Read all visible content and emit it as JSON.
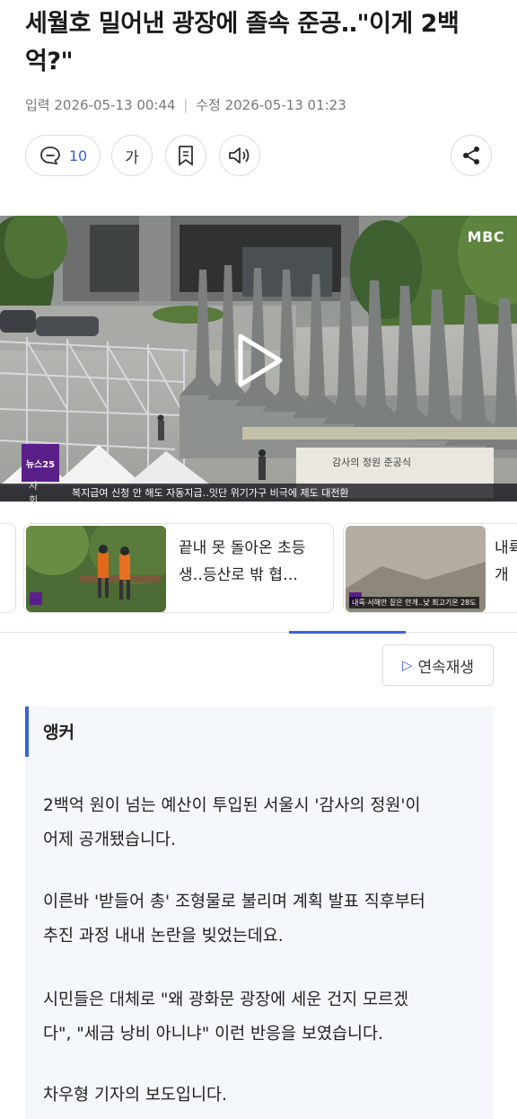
{
  "article": {
    "headline": "세월호 밀어낸 광장에 졸속 준공‥\"이게 2백억?\"",
    "published_label": "입력",
    "published_time": "2026-05-13 00:44",
    "updated_label": "수정",
    "updated_time": "2026-05-13 01:23"
  },
  "actions": {
    "comment_count": "10",
    "font_label": "가"
  },
  "video": {
    "logo": "MBC",
    "news_badge": "뉴스25",
    "ticker_category": "사회",
    "ticker_text": "복지급여 신청 안 해도 자동지급‥잇단 위기가구 비극에 제도 대전환",
    "sign_text": "감사의 정원 준공식"
  },
  "related": [
    {
      "title": "끝내 못 돌아온 초등생‥등산로 밖 협…",
      "caption": ""
    },
    {
      "title": "내륙 안개",
      "caption": "내륙·서해안 짙은 안개‥낮 최고기온 28도"
    }
  ],
  "autoplay_label": "연속재생",
  "body": {
    "anchor_label": "앵커",
    "paragraphs": [
      [
        "2백억 원이 넘는 예산이 투입된 서울시 '감사의 정원'이",
        "어제 공개됐습니다."
      ],
      [
        "이른바 '받들어 총' 조형물로 불리며 계획 발표 직후부터",
        "추진 과정 내내 논란을 빚었는데요."
      ],
      [
        "시민들은 대체로 \"왜 광화문 광장에 세운 건지 모르겠",
        "다\", \"세금 낭비 아니냐\" 이런 반응을 보였습니다."
      ],
      [
        "차우형 기자의 보도입니다."
      ]
    ]
  },
  "colors": {
    "accent": "#3a62d8",
    "body_bg": "#f4f7fc",
    "badge_purple": "#5b1f8a"
  }
}
